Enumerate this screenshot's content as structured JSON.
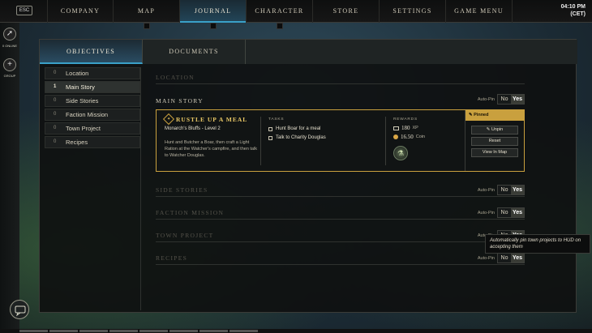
{
  "topnav": {
    "esc_label": "ESC",
    "tabs": [
      {
        "label": "COMPANY"
      },
      {
        "label": "MAP"
      },
      {
        "label": "JOURNAL"
      },
      {
        "label": "CHARACTER"
      },
      {
        "label": "STORE"
      },
      {
        "label": "SETTINGS"
      },
      {
        "label": "GAME MENU"
      }
    ],
    "active_tab": "JOURNAL",
    "time": "04:10 PM",
    "timezone": "(CET)"
  },
  "rail": {
    "online_label": "0 ONLINE",
    "group_label": "GROUP"
  },
  "journal": {
    "subtabs": [
      {
        "label": "OBJECTIVES"
      },
      {
        "label": "DOCUMENTS"
      }
    ],
    "active_subtab": "OBJECTIVES",
    "nav": [
      {
        "count": "0",
        "label": "Location"
      },
      {
        "count": "1",
        "label": "Main Story"
      },
      {
        "count": "0",
        "label": "Side Stories"
      },
      {
        "count": "0",
        "label": "Faction Mission"
      },
      {
        "count": "0",
        "label": "Town Project"
      },
      {
        "count": "0",
        "label": "Recipes"
      }
    ],
    "active_nav": "Main Story"
  },
  "sections": {
    "location": {
      "title": "LOCATION"
    },
    "main_story": {
      "title": "MAIN STORY"
    },
    "side_stories": {
      "title": "SIDE STORIES"
    },
    "faction_mission": {
      "title": "FACTION MISSION"
    },
    "town_project": {
      "title": "TOWN PROJECT"
    },
    "recipes": {
      "title": "RECIPES"
    },
    "autopin_label": "Auto-Pin",
    "no_label": "No",
    "yes_label": "Yes"
  },
  "quest": {
    "icon": "quest-diamond-icon",
    "title": "RUSTLE UP A MEAL",
    "subtitle": "Monarch's Bluffs - Level 2",
    "description": "Hunt and Butcher a Boar, then craft a Light Ration at the Watcher's campfire, and then talk to Watcher Douglas.",
    "tasks_header": "TASKS",
    "tasks": [
      {
        "label": "Hunt Boar for a meal"
      },
      {
        "label": "Talk to Charity Douglas"
      }
    ],
    "rewards_header": "REWARDS",
    "xp_value": "180",
    "xp_unit": "XP",
    "coin_value": "16.50",
    "coin_unit": "Coin",
    "pinned_label": "Pinned",
    "unpin_label": "Unpin",
    "reset_label": "Reset",
    "view_in_map_label": "View In Map"
  },
  "tooltip": {
    "text": "Automatically pin town projects to HUD on accepting them"
  },
  "colors": {
    "accent_gold": "#c9a03e",
    "accent_blue": "#3aa0c8"
  }
}
